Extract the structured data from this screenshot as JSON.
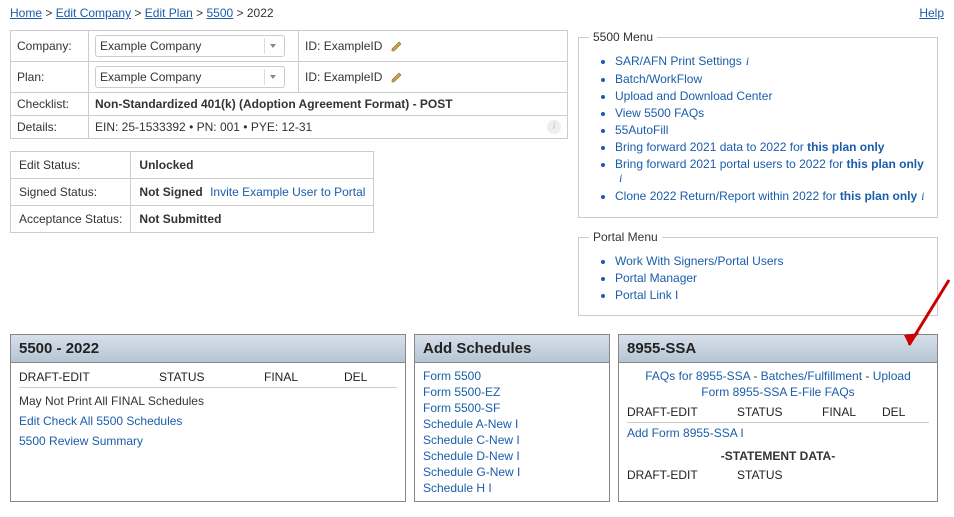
{
  "breadcrumb": {
    "home": "Home",
    "edit_company": "Edit Company",
    "edit_plan": "Edit Plan",
    "n5500": "5500",
    "year": "2022",
    "help": "Help"
  },
  "info": {
    "company_lab": "Company:",
    "company_val": "Example Company",
    "company_id_lab": "ID:",
    "company_id_val": "ExampleID",
    "plan_lab": "Plan:",
    "plan_val": "Example Company",
    "plan_id_lab": "ID:",
    "plan_id_val": "ExampleID",
    "checklist_lab": "Checklist:",
    "checklist_val": "Non-Standardized 401(k) (Adoption Agreement Format) - POST",
    "details_lab": "Details:",
    "details_val": "EIN: 25-1533392 • PN: 001 • PYE: 12-31"
  },
  "status": {
    "edit_lab": "Edit Status:",
    "edit_val": "Unlocked",
    "signed_lab": "Signed Status:",
    "signed_val": "Not Signed",
    "signed_link": "Invite Example User to Portal",
    "accept_lab": "Acceptance Status:",
    "accept_val": "Not Submitted"
  },
  "menu5500": {
    "legend": "5500 Menu",
    "items": [
      "SAR/AFN Print Settings",
      "Batch/WorkFlow",
      "Upload and Download Center",
      "View 5500 FAQs",
      "55AutoFill"
    ],
    "bf1_a": "Bring forward 2021 data to 2022 for ",
    "bf1_b": "this plan only",
    "bf2_a": "Bring forward 2021 portal users to 2022 for ",
    "bf2_b": "this plan only",
    "cl_a": "Clone 2022 Return/Report within 2022 for ",
    "cl_b": "this plan only"
  },
  "portal": {
    "legend": "Portal Menu",
    "items": [
      "Work With Signers/Portal Users",
      "Portal Manager",
      "Portal Link I"
    ]
  },
  "panel5500": {
    "title": "5500 - 2022",
    "cols": {
      "c1": "DRAFT-EDIT",
      "c2": "STATUS",
      "c3": "FINAL",
      "c4": "DEL"
    },
    "note": "May Not Print All FINAL Schedules",
    "link1": "Edit Check All 5500 Schedules",
    "link2": "5500 Review Summary"
  },
  "panelAdd": {
    "title": "Add Schedules",
    "links": [
      "Form 5500",
      "Form 5500-EZ",
      "Form 5500-SF",
      "Schedule A-New I",
      "Schedule C-New I",
      "Schedule D-New I",
      "Schedule G-New I",
      "Schedule H I"
    ]
  },
  "panel8955": {
    "title": "8955-SSA",
    "faq": "FAQs for 8955-SSA",
    "batches": "Batches/Fulfillment",
    "upload": "Upload",
    "efaq": "Form 8955-SSA E-File FAQs",
    "cols": {
      "c1": "DRAFT-EDIT",
      "c2": "STATUS",
      "c3": "FINAL",
      "c4": "DEL"
    },
    "addform": "Add Form 8955-SSA I",
    "stmt": "-STATEMENT DATA-",
    "cols2": {
      "c1": "DRAFT-EDIT",
      "c2": "STATUS"
    }
  }
}
